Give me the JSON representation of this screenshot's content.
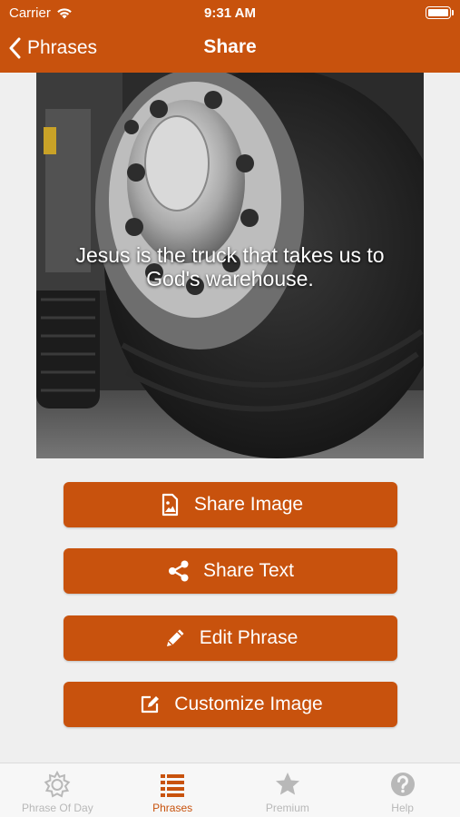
{
  "status_bar": {
    "carrier": "Carrier",
    "time": "9:31 AM"
  },
  "nav": {
    "back_label": "Phrases",
    "title": "Share"
  },
  "card": {
    "phrase": "Jesus is the truck that takes us to God's warehouse."
  },
  "actions": [
    {
      "label": "Share Image",
      "icon": "image-file-icon"
    },
    {
      "label": "Share Text",
      "icon": "share-icon"
    },
    {
      "label": "Edit Phrase",
      "icon": "pencil-icon"
    },
    {
      "label": "Customize Image",
      "icon": "edit-square-icon"
    }
  ],
  "tabbar": {
    "tabs": [
      {
        "label": "Phrase Of Day",
        "icon": "sun-icon",
        "active": false
      },
      {
        "label": "Phrases",
        "icon": "list-icon",
        "active": true
      },
      {
        "label": "Premium",
        "icon": "star-icon",
        "active": false
      },
      {
        "label": "Help",
        "icon": "question-icon",
        "active": false
      }
    ]
  },
  "colors": {
    "accent": "#c8520d",
    "tab_inactive": "#b8b8b8",
    "background": "#efefef"
  }
}
